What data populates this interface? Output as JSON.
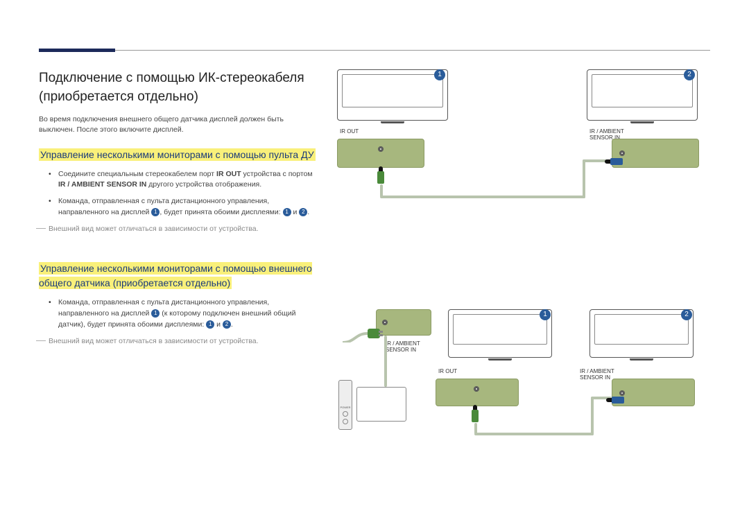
{
  "title": "Подключение с помощью ИК-стереокабеля (приобретается отдельно)",
  "intro": "Во время подключения внешнего общего датчика дисплей должен быть выключен. После этого включите дисплей.",
  "section1": {
    "heading": "Управление несколькими мониторами с помощью пульта ДУ",
    "bullet1_pre": "Соедините специальным стереокабелем порт ",
    "bullet1_b1": "IR OUT",
    "bullet1_mid": " устройства с портом ",
    "bullet1_b2": "IR / AMBIENT SENSOR IN",
    "bullet1_post": " другого устройства отображения.",
    "bullet2_pre": "Команда, отправленная с пульта дистанционного управления, направленного на дисплей ",
    "bullet2_mid": ", будет принята обоими дисплеями: ",
    "bullet2_and": " и ",
    "bullet2_end": ".",
    "footnote": "Внешний вид может отличаться в зависимости от устройства."
  },
  "section2": {
    "heading": "Управление несколькими мониторами с помощью внешнего общего датчика (приобретается отдельно)",
    "bullet1_pre": "Команда, отправленная с пульта дистанционного управления, направленного на дисплей ",
    "bullet1_mid": " (к которому подключен внешний общий датчик), будет принята обоими дисплеями: ",
    "bullet1_and": " и ",
    "bullet1_end": ".",
    "footnote": "Внешний вид может отличаться в зависимости от устройства."
  },
  "labels": {
    "ir_out": "IR OUT",
    "ir_ambient": "IR / AMBIENT SENSOR IN",
    "n1": "1",
    "n2": "2"
  },
  "remote": {
    "power": "POWER"
  }
}
